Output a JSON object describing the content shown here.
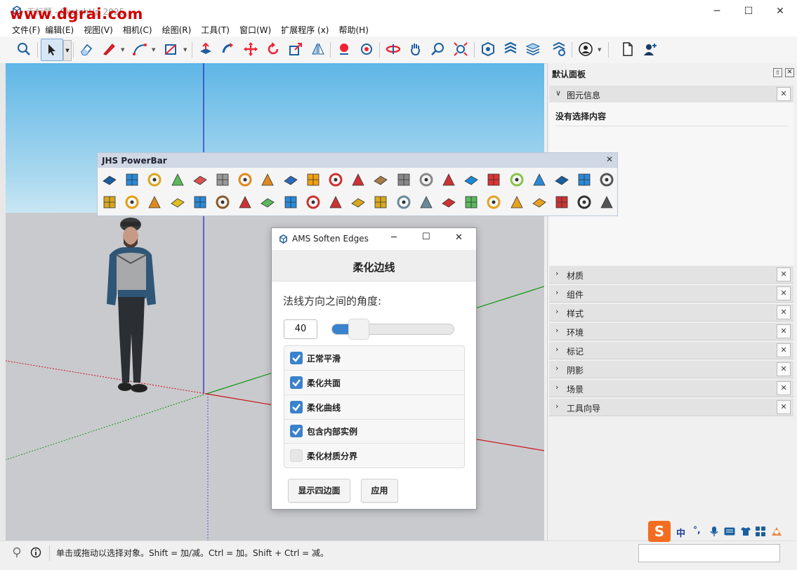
{
  "window": {
    "title": "无标题 - SketchUp 2025",
    "watermark": "www.dgrai.com",
    "minimize": "─",
    "maximize": "☐",
    "close": "✕"
  },
  "menu": [
    "文件(F)",
    "编辑(E)",
    "视图(V)",
    "相机(C)",
    "绘图(R)",
    "工具(T)",
    "窗口(W)",
    "扩展程序 (x)",
    "帮助(H)"
  ],
  "toolbar": {
    "icons": [
      "search-icon",
      "select-arrow-icon",
      "eraser-icon",
      "pencil-line-icon",
      "arc-icon",
      "rectangle-icon",
      "push-pull-icon",
      "follow-me-icon",
      "move-icon",
      "rotate-icon",
      "scale-icon",
      "tape-icon",
      "orbit-icon",
      "pan-icon",
      "zoom-icon",
      "zoom-extents-icon",
      "warehouse-icon",
      "layers-icon",
      "styles-icon",
      "settings-icon",
      "user-circle-icon",
      "new-file-icon",
      "add-user-icon"
    ]
  },
  "panel": {
    "title": "默认面板",
    "entity_info": {
      "label": "图元信息",
      "empty_text": "没有选择内容"
    },
    "sections": [
      "材质",
      "组件",
      "样式",
      "环境",
      "标记",
      "阴影",
      "场景",
      "工具向导"
    ]
  },
  "powerbar": {
    "title": "JHS PowerBar",
    "close": "✕"
  },
  "dialog": {
    "title": "AMS Soften Edges",
    "heading": "柔化边线",
    "angle_label": "法线方向之间的角度:",
    "angle_value": "40",
    "angle_fraction": 0.22,
    "options": [
      {
        "label": "正常平滑",
        "checked": true
      },
      {
        "label": "柔化共面",
        "checked": true
      },
      {
        "label": "柔化曲线",
        "checked": true
      },
      {
        "label": "包含内部实例",
        "checked": true
      },
      {
        "label": "柔化材质分界",
        "checked": false
      }
    ],
    "show_quads_button": "显示四边面",
    "apply_button": "应用"
  },
  "status": {
    "text": "单击或拖动以选择对象。Shift = 加/减。Ctrl = 加。Shift + Ctrl = 减。"
  },
  "ime": {
    "mode": "中",
    "punct": "°,"
  },
  "colors": {
    "accent": "#3a82cc",
    "sky": "#5fb6e6",
    "ground": "#c9cace",
    "axis_red": "#d00000",
    "axis_green": "#00a000",
    "axis_blue": "#0000c0"
  }
}
